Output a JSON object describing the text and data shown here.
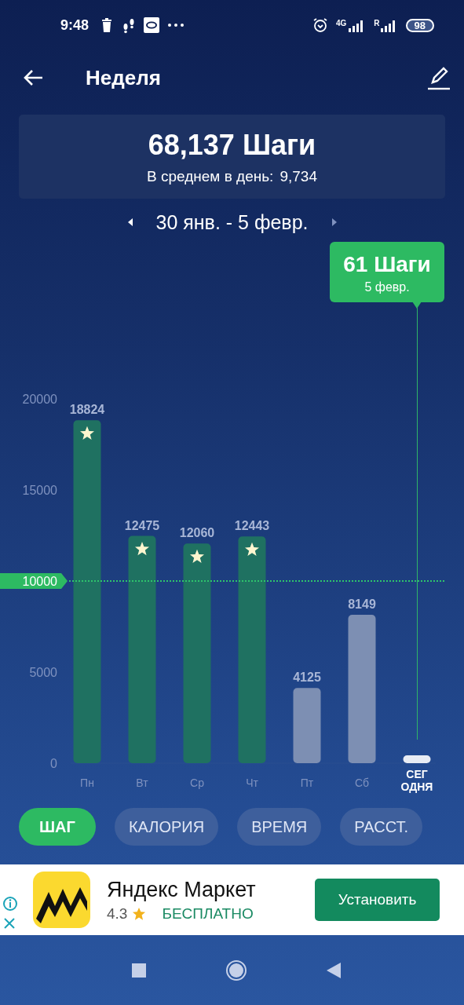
{
  "status_bar": {
    "time": "9:48",
    "network": "4G",
    "roaming": "R",
    "battery": "98"
  },
  "header": {
    "title": "Неделя"
  },
  "summary": {
    "total": "68,137 Шаги",
    "average_label": "В среднем в день:",
    "average": "9,734"
  },
  "period": {
    "label": "30 янв. - 5 февр."
  },
  "chart": {
    "chart_data": {
      "type": "bar",
      "categories": [
        "Пн",
        "Вт",
        "Ср",
        "Чт",
        "Пт",
        "Сб",
        "СЕГ\nОДНЯ"
      ],
      "values": [
        18824,
        12475,
        12060,
        12443,
        4125,
        8149,
        61
      ],
      "value_labels": [
        "18824",
        "12475",
        "12060",
        "12443",
        "4125",
        "8149",
        null
      ],
      "yticks": [
        0,
        5000,
        {
          "value": 10000,
          "label": "10000"
        },
        15000,
        20000
      ],
      "ylim": [
        0,
        20000
      ]
    },
    "tooltip": {
      "title": "61 Шаги",
      "subtitle": "5 февр."
    }
  },
  "metric_tabs": [
    {
      "label": "ШАГ",
      "selected": true
    },
    {
      "label": "КАЛОРИЯ",
      "selected": false
    },
    {
      "label": "ВРЕМЯ",
      "selected": false
    },
    {
      "label": "РАССТ.",
      "selected": false
    }
  ],
  "ad": {
    "title": "Яндекс Маркет",
    "rating": "4.3",
    "price": "БЕСПЛАТНО",
    "button": "Установить"
  }
}
